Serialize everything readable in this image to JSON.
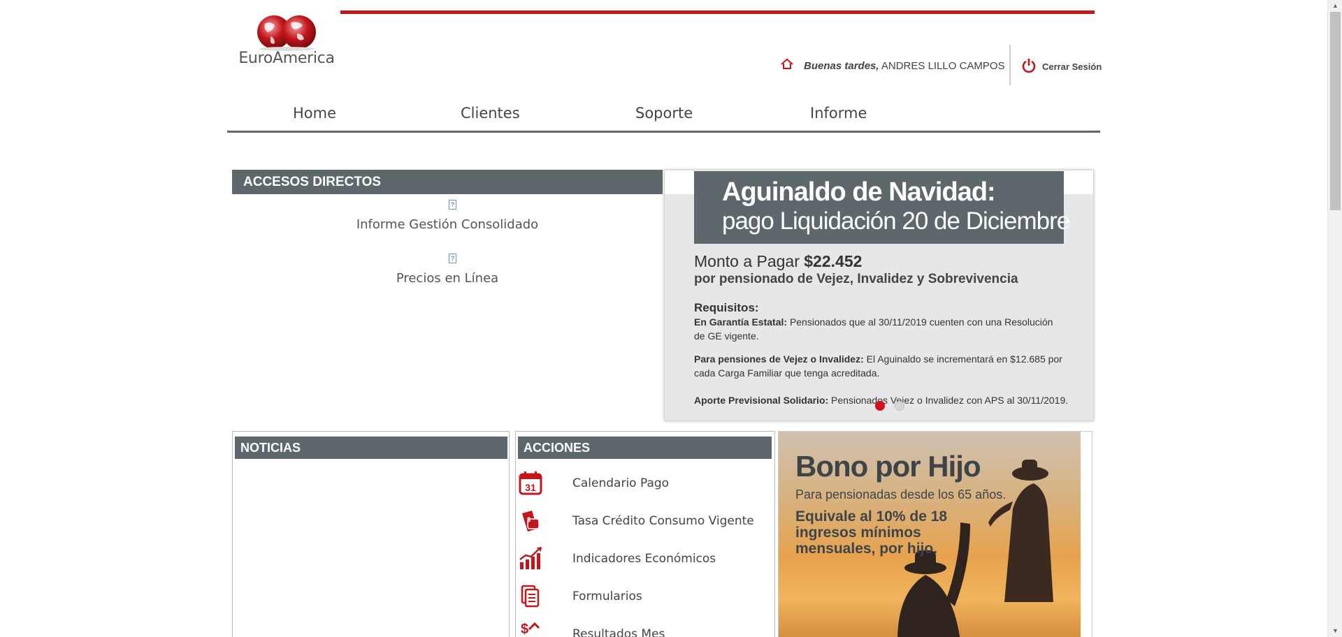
{
  "header": {
    "brand": "EuroAmerica",
    "greeting_prefix": "Buenas tardes,",
    "user_name": "ANDRES LILLO CAMPOS",
    "logout_label": "Cerrar Sesión",
    "accent_color": "#c3161c"
  },
  "nav": {
    "items": [
      {
        "label": "Home"
      },
      {
        "label": "Clientes"
      },
      {
        "label": "Soporte"
      },
      {
        "label": "Informe"
      }
    ]
  },
  "accesos": {
    "title": "ACCESOS DIRECTOS",
    "links": [
      {
        "label": "Informe Gestión Consolidado"
      },
      {
        "label": "Precios en Línea"
      }
    ]
  },
  "banner": {
    "title": "Aguinaldo de Navidad:",
    "subtitle": "pago Liquidación 20 de Diciembre",
    "amount_prefix": "Monto a Pagar",
    "amount": "$22.452",
    "amount_detail": "por pensionado de Vejez, Invalidez y Sobrevivencia",
    "requisitos_title": "Requisitos:",
    "req1_bold": "En Garantía Estatal:",
    "req1_text": "Pensionados que al 30/11/2019 cuenten con una Resolución",
    "req1_text2": "de GE vigente.",
    "req2_bold": "Para pensiones de Vejez o Invalidez:",
    "req2_text": "El Aguinaldo se incrementará en $12.685 por",
    "req2_text2": "cada Carga Familiar que tenga acreditada.",
    "req3_bold": "Aporte Previsional Solidario:",
    "req3_text": "Pensionados Vejez o Invalidez con APS al 30/11/2019.",
    "active_slide": 1,
    "slide_count": 2
  },
  "noticias": {
    "title": "NOTICIAS"
  },
  "acciones": {
    "title": "ACCIONES",
    "items": [
      {
        "label": "Calendario Pago",
        "icon": "calendar-icon"
      },
      {
        "label": "Tasa Crédito Consumo Vigente",
        "icon": "wallet-icon"
      },
      {
        "label": "Indicadores Económicos",
        "icon": "chart-icon"
      },
      {
        "label": "Formularios",
        "icon": "document-icon"
      },
      {
        "label": "Resultados Mes",
        "icon": "money-icon"
      }
    ]
  },
  "bono": {
    "title": "Bono por Hijo",
    "subtitle": "Para pensionadas desde los 65 años.",
    "line1": "Equivale al 10% de 18",
    "line2": "ingresos mínimos",
    "line3": "mensuales, por hijo."
  }
}
